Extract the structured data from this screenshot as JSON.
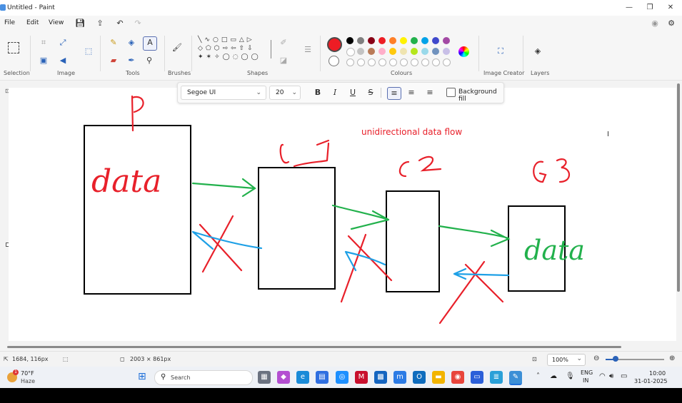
{
  "window": {
    "title": "Untitled - Paint",
    "minimize_glyph": "—",
    "maximize_glyph": "❐",
    "close_glyph": "✕"
  },
  "menu": {
    "file": "File",
    "edit": "Edit",
    "view": "View"
  },
  "ribbon": {
    "groups": {
      "selection": "Selection",
      "image": "Image",
      "tools": "Tools",
      "brushes": "Brushes",
      "shapes": "Shapes",
      "colours": "Colours",
      "image_creator": "Image Creator",
      "layers": "Layers"
    },
    "primary_color": "#ee1c24",
    "palette_row1": [
      "#000000",
      "#7f7f7f",
      "#880015",
      "#ed1c24",
      "#ff7f27",
      "#fff200",
      "#22b14c",
      "#00a2e8",
      "#3f48cc",
      "#a349a4"
    ],
    "palette_row2": [
      "#ffffff",
      "#c3c3c3",
      "#b97a57",
      "#ffaec9",
      "#ffc90e",
      "#efe4b0",
      "#b5e61d",
      "#99d9ea",
      "#7092be",
      "#c8bfe7"
    ]
  },
  "text_toolbar": {
    "font": "Segoe UI",
    "size": "20",
    "bold": "B",
    "italic": "I",
    "underline": "U",
    "strike": "S",
    "background_fill": "Background fill"
  },
  "canvas": {
    "typed_text": "unidirectional data flow",
    "handwriting": {
      "p_label": "P",
      "data_left": "data",
      "c1": "C1",
      "c2": "C2",
      "c3": "C3",
      "data_right": "data"
    },
    "ink_colors": {
      "red": "#e8202a",
      "green": "#22b14c",
      "blue": "#1ea0e6",
      "black": "#000000"
    }
  },
  "status": {
    "cursor_pos": "1684, 116px",
    "canvas_size": "2003 × 861px",
    "zoom": "100%"
  },
  "taskbar": {
    "weather_temp": "70°F",
    "weather_desc": "Haze",
    "search_placeholder": "Search",
    "lang1": "ENG",
    "lang2": "IN",
    "time": "10:00",
    "date": "31-01-2025"
  }
}
